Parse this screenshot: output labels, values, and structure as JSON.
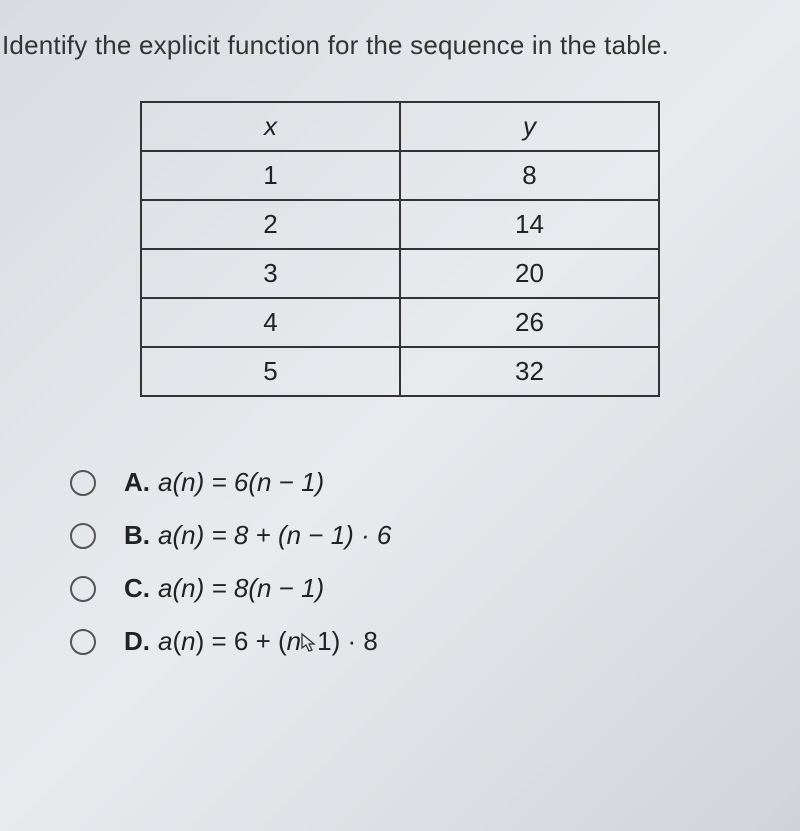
{
  "question": "Identify the explicit function for the sequence in the table.",
  "table": {
    "headers": {
      "x": "x",
      "y": "y"
    },
    "rows": [
      {
        "x": "1",
        "y": "8"
      },
      {
        "x": "2",
        "y": "14"
      },
      {
        "x": "3",
        "y": "20"
      },
      {
        "x": "4",
        "y": "26"
      },
      {
        "x": "5",
        "y": "32"
      }
    ]
  },
  "options": [
    {
      "letter": "A.",
      "formula": "a(n) = 6(n − 1)"
    },
    {
      "letter": "B.",
      "formula": "a(n) = 8 + (n − 1) · 6"
    },
    {
      "letter": "C.",
      "formula": "a(n) = 8(n − 1)"
    },
    {
      "letter": "D.",
      "formula": "a(n) = 6 + (n − 1) · 8"
    }
  ],
  "chart_data": {
    "type": "table",
    "columns": [
      "x",
      "y"
    ],
    "rows": [
      [
        1,
        8
      ],
      [
        2,
        14
      ],
      [
        3,
        20
      ],
      [
        4,
        26
      ],
      [
        5,
        32
      ]
    ]
  }
}
